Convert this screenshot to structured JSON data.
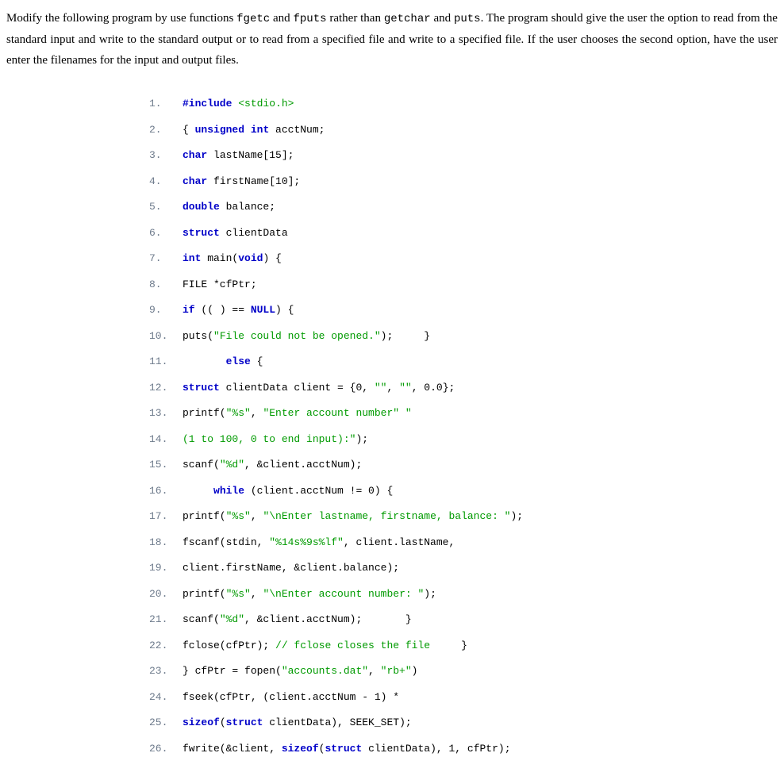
{
  "prompt": {
    "p1a": "Modify the following program by use functions ",
    "fgetc": "fgetc",
    "p1b": " and ",
    "fputs": "fputs",
    "p1c": " rather than ",
    "getchar": "getchar",
    "p1d": " and ",
    "puts": "puts",
    "p1e": ". The program should give the user the option to read from the standard input and write to the standard output or to read from a specified file and write to a specified file. If the user chooses the second option, have the user enter the filenames for the input and output files."
  },
  "code": {
    "l1": {
      "n": "1.",
      "pp": "#include",
      "inc": " <stdio.h>"
    },
    "l2": {
      "n": "2.",
      "a": "{ ",
      "kw1": "unsigned",
      "sp1": " ",
      "kw2": "int",
      "b": " acctNum;"
    },
    "l3": {
      "n": "3.",
      "kw": "char",
      "b": " lastName[15];"
    },
    "l4": {
      "n": "4.",
      "kw": "char",
      "b": " firstName[10];"
    },
    "l5": {
      "n": "5.",
      "kw": "double",
      "b": " balance;"
    },
    "l6": {
      "n": "6.",
      "kw": "struct",
      "b": " clientData"
    },
    "l7": {
      "n": "7.",
      "kw1": "int",
      "b1": " main(",
      "kw2": "void",
      "b2": ") {"
    },
    "l8": {
      "n": "8.",
      "a": "FILE *cfPtr;"
    },
    "l9": {
      "n": "9.",
      "kw": "if",
      "a": " (( ) == ",
      "nv": "NULL",
      "b": ") {"
    },
    "l10": {
      "n": "10.",
      "a": "puts(",
      "s": "\"File could not be opened.\"",
      "b": ");     }"
    },
    "l11": {
      "n": "11.",
      "pad": "       ",
      "kw": "else",
      "b": " {"
    },
    "l12": {
      "n": "12.",
      "kw": "struct",
      "a": " clientData client = {0, ",
      "s1": "\"\"",
      "b": ", ",
      "s2": "\"\"",
      "c": ", 0.0};"
    },
    "l13": {
      "n": "13.",
      "a": "printf(",
      "s1": "\"%s\"",
      "b": ", ",
      "s2": "\"Enter account number\"",
      "c": " ",
      "s3": "\""
    },
    "l14": {
      "n": "14.",
      "s": "(1 to 100, 0 to end input):\"",
      "b": ");"
    },
    "l15": {
      "n": "15.",
      "a": "scanf(",
      "s": "\"%d\"",
      "b": ", &client.acctNum);"
    },
    "l16": {
      "n": "16.",
      "pad": "     ",
      "kw": "while",
      "b": " (client.acctNum != 0) {"
    },
    "l17": {
      "n": "17.",
      "a": "printf(",
      "s1": "\"%s\"",
      "b": ", ",
      "s2": "\"\\nEnter lastname, firstname, balance: \"",
      "c": ");"
    },
    "l18": {
      "n": "18.",
      "a": "fscanf(stdin, ",
      "s": "\"%14s%9s%lf\"",
      "b": ", client.lastName,"
    },
    "l19": {
      "n": "19.",
      "a": "client.firstName, &client.balance);"
    },
    "l20": {
      "n": "20.",
      "a": "printf(",
      "s1": "\"%s\"",
      "b": ", ",
      "s2": "\"\\nEnter account number: \"",
      "c": ");"
    },
    "l21": {
      "n": "21.",
      "a": "scanf(",
      "s": "\"%d\"",
      "b": ", &client.acctNum);       }"
    },
    "l22": {
      "n": "22.",
      "a": "fclose(cfPtr); ",
      "cmt": "// fclose closes the file",
      "b": "     }"
    },
    "l23": {
      "n": "23.",
      "a": "} cfPtr = fopen(",
      "s1": "\"accounts.dat\"",
      "b": ", ",
      "s2": "\"rb+\"",
      "c": ")"
    },
    "l24": {
      "n": "24.",
      "a": "fseek(cfPtr, (client.acctNum - 1) *"
    },
    "l25": {
      "n": "25.",
      "kw1": "sizeof",
      "a": "(",
      "kw2": "struct",
      "b": " clientData), SEEK_SET);"
    },
    "l26": {
      "n": "26.",
      "a": "fwrite(&client, ",
      "kw1": "sizeof",
      "b": "(",
      "kw2": "struct",
      "c": " clientData), 1, cfPtr);"
    }
  }
}
